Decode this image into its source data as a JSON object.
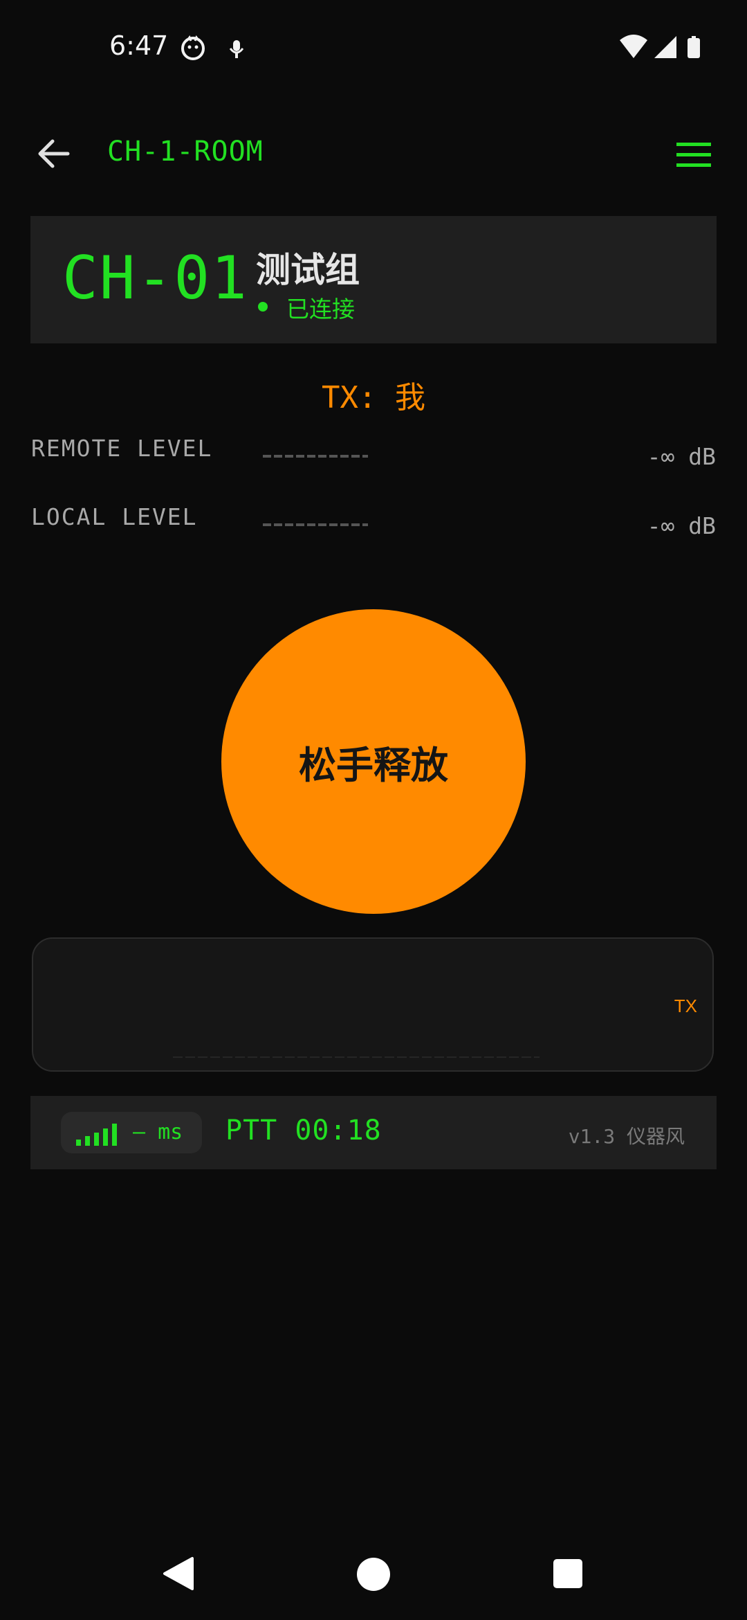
{
  "status_bar": {
    "time": "6:47",
    "left_icons": [
      "cat-face-icon",
      "mic-icon"
    ],
    "right_icons": [
      "wifi-icon",
      "cell-signal-icon",
      "battery-icon"
    ]
  },
  "app_bar": {
    "back_icon": "arrow-left-icon",
    "title": "CH-1-ROOM",
    "menu_icon": "hamburger-menu-icon"
  },
  "channel": {
    "id": "CH-01",
    "group_name": "测试组",
    "status": "已连接"
  },
  "tx_status": "TX: 我",
  "levels": {
    "remote": {
      "label": "REMOTE LEVEL",
      "value": "-∞ dB"
    },
    "local": {
      "label": "LOCAL LEVEL",
      "value": "-∞ dB"
    }
  },
  "ptt_button": {
    "label": "松手释放"
  },
  "waveform": {
    "tag": "TX"
  },
  "footer": {
    "signal_bars": 5,
    "latency": "— ms",
    "ptt_timer": "PTT 00:18",
    "version": "v1.3 仪器风"
  },
  "colors": {
    "background": "#0b0b0b",
    "accent_green": "#22e022",
    "accent_orange": "#ff8a00",
    "card": "#1f1f1f",
    "muted_text": "#a9a9a9"
  }
}
